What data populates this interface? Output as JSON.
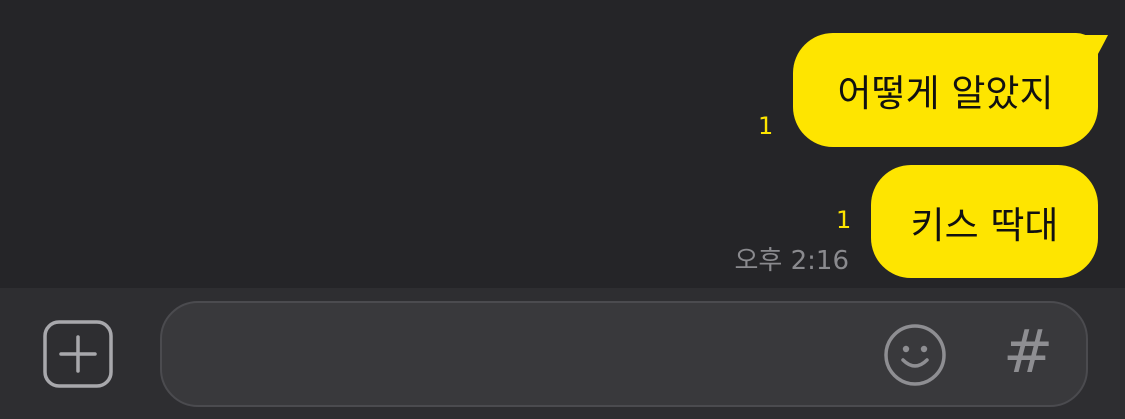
{
  "messages": [
    {
      "text": "어떻게 알았지",
      "unread_count": "1"
    },
    {
      "text": "키스 딱대",
      "unread_count": "1"
    }
  ],
  "timestamp": "오후 2:16",
  "composer": {
    "placeholder": "",
    "plus_icon": "plus-square-icon",
    "emoji_icon": "emoji-smile-icon",
    "hash_label": "#"
  },
  "colors": {
    "background": "#252528",
    "bubble": "#fee500",
    "unread": "#fee500",
    "input_bar": "#2e2e31",
    "input_field": "#39393c"
  }
}
